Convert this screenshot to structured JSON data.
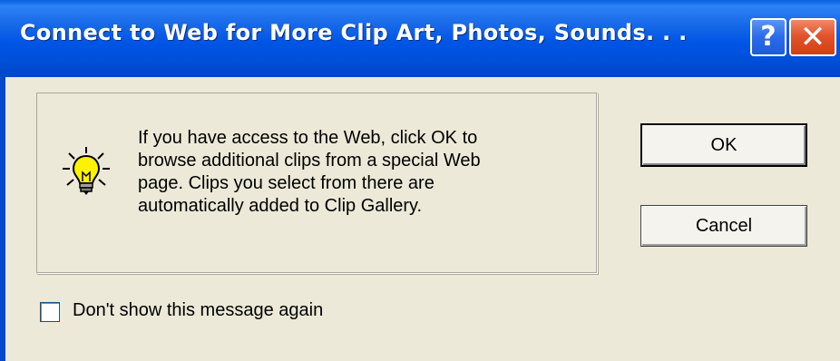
{
  "window": {
    "title": "Connect to Web for More Clip Art, Photos, Sounds. . .",
    "help_glyph": "?",
    "close_glyph": "✕",
    "titlebar_color": "#0055E5",
    "body_color": "#ECE9D8"
  },
  "message": {
    "icon": "lightbulb-icon",
    "lines": [
      "If you have access to the Web, click OK to",
      "browse additional clips from a special Web",
      "page.  Clips you select from there are",
      "automatically added to Clip Gallery."
    ]
  },
  "buttons": {
    "ok_label": "OK",
    "cancel_label": "Cancel"
  },
  "option": {
    "checkbox_label": "Don't show this message again",
    "checked": false
  }
}
